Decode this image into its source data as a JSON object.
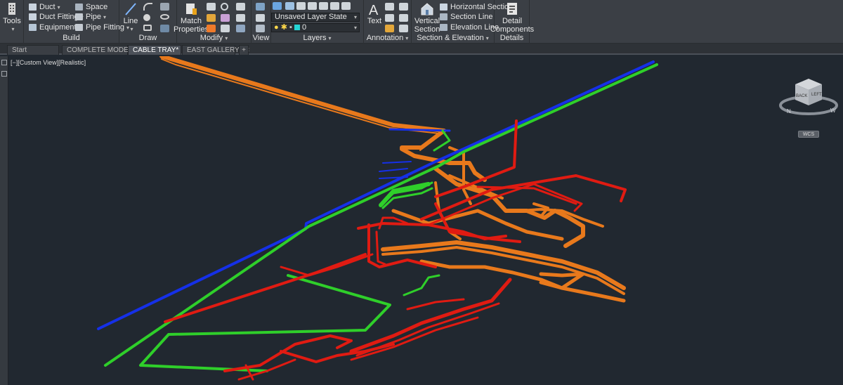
{
  "ribbon": {
    "tools": {
      "label": "Tools"
    },
    "build": {
      "title": "Build",
      "items": [
        "Duct",
        "Duct Fitting",
        "Equipment",
        "Space",
        "Pipe",
        "Pipe Fitting"
      ]
    },
    "draw": {
      "title": "Draw",
      "line_label": "Line"
    },
    "modify": {
      "title": "Modify",
      "match_properties_line1": "Match",
      "match_properties_line2": "Properties"
    },
    "view": {
      "title": "View"
    },
    "layers": {
      "title": "Layers",
      "layer_state": "Unsaved Layer State",
      "current_layer": "0"
    },
    "annotation": {
      "title": "Annotation",
      "text_label": "Text"
    },
    "section_elevation": {
      "title": "Section & Elevation",
      "vertical_section_line1": "Vertical",
      "vertical_section_line2": "Section",
      "items": [
        "Horizontal Section",
        "Section Line",
        "Elevation Line"
      ]
    },
    "details": {
      "title": "Details",
      "detail_components_line1": "Detail",
      "detail_components_line2": "Components"
    }
  },
  "tabs": [
    {
      "label": "Start",
      "active": false,
      "closable": false
    },
    {
      "label": "COMPLETE MODEL*",
      "active": false,
      "closable": true
    },
    {
      "label": "CABLE TRAY*",
      "active": true,
      "closable": true
    },
    {
      "label": "EAST GALLERY*",
      "active": false,
      "closable": true
    }
  ],
  "new_tab_label": "+",
  "viewport": {
    "label": "[−][Custom View][Realistic]",
    "viewcube_faces": [
      "BACK",
      "LEFT"
    ],
    "compass": [
      "N",
      "W"
    ],
    "wcs_label": "WCS"
  },
  "colors": {
    "ribbon_bg": "#3b3f45",
    "canvas_bg": "#212830",
    "orange_tray": "#e8791c",
    "red_pipe": "#e01b12",
    "green_pipe": "#2fcf2a",
    "blue_pipe": "#1530e8",
    "layer_color_cyan": "#24d4d4"
  },
  "icons": [
    "tools-icon",
    "duct-icon",
    "duct-fitting-icon",
    "equipment-icon",
    "space-icon",
    "pipe-icon",
    "pipe-fitting-icon",
    "line-icon",
    "match-properties-icon",
    "text-icon",
    "vertical-section-icon",
    "horizontal-section-icon",
    "section-line-icon",
    "elevation-line-icon",
    "detail-components-icon",
    "viewcube-icon"
  ]
}
